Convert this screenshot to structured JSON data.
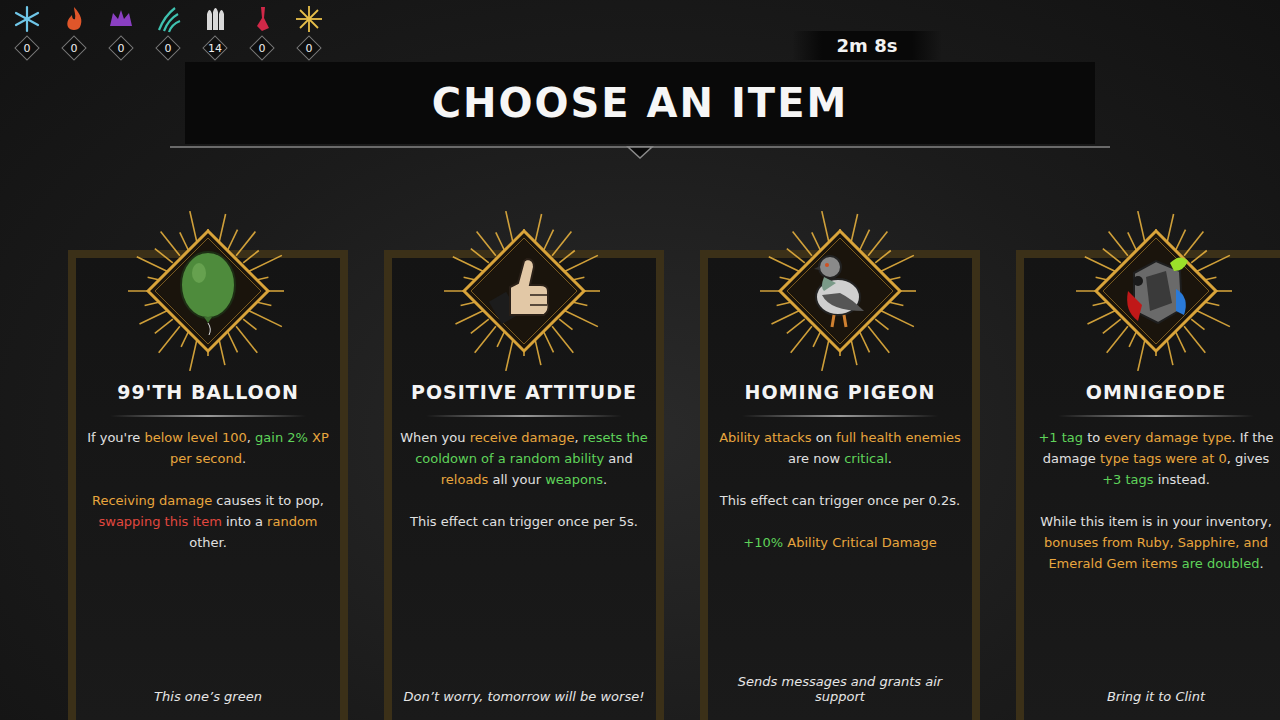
{
  "resources": [
    {
      "count": "0",
      "color": "#6fc6e8"
    },
    {
      "count": "0",
      "color": "#e0562a"
    },
    {
      "count": "0",
      "color": "#8a3fc2"
    },
    {
      "count": "0",
      "color": "#3fc2b0"
    },
    {
      "count": "14",
      "color": "#d8d8d8"
    },
    {
      "count": "0",
      "color": "#d02848"
    },
    {
      "count": "0",
      "color": "#e8c04a"
    }
  ],
  "timer": "2m 8s",
  "title": "CHOOSE AN ITEM",
  "cards": [
    {
      "name": "99'TH BALLOON",
      "paragraphs": [
        [
          {
            "text": "If you're ",
            "kind": "plain"
          },
          {
            "text": "below level 100",
            "kind": "gold"
          },
          {
            "text": ", ",
            "kind": "plain"
          },
          {
            "text": "gain 2%",
            "kind": "green"
          },
          {
            "text": " XP per second",
            "kind": "gold"
          },
          {
            "text": ".",
            "kind": "plain"
          }
        ],
        [
          {
            "text": "Receiving damage",
            "kind": "gold"
          },
          {
            "text": " causes it to pop, ",
            "kind": "plain"
          },
          {
            "text": "swapping this item",
            "kind": "red"
          },
          {
            "text": " into a ",
            "kind": "plain"
          },
          {
            "text": "random",
            "kind": "gold"
          },
          {
            "text": " other.",
            "kind": "plain"
          }
        ]
      ],
      "flavor": "This one’s green"
    },
    {
      "name": "POSITIVE ATTITUDE",
      "paragraphs": [
        [
          {
            "text": "When you ",
            "kind": "plain"
          },
          {
            "text": "receive damage",
            "kind": "gold"
          },
          {
            "text": ", ",
            "kind": "plain"
          },
          {
            "text": "resets the cooldown of a random ability",
            "kind": "green"
          },
          {
            "text": " and ",
            "kind": "plain"
          },
          {
            "text": "reloads",
            "kind": "gold"
          },
          {
            "text": " all your ",
            "kind": "plain"
          },
          {
            "text": "weapons",
            "kind": "green"
          },
          {
            "text": ".",
            "kind": "plain"
          }
        ],
        [
          {
            "text": "This effect can trigger once per 5s.",
            "kind": "plain"
          }
        ]
      ],
      "flavor": "Don’t worry, tomorrow will be worse!"
    },
    {
      "name": "HOMING PIGEON",
      "paragraphs": [
        [
          {
            "text": "Ability attacks",
            "kind": "gold"
          },
          {
            "text": " on ",
            "kind": "plain"
          },
          {
            "text": "full health enemies",
            "kind": "gold"
          },
          {
            "text": " are now ",
            "kind": "plain"
          },
          {
            "text": "critical",
            "kind": "green"
          },
          {
            "text": ".",
            "kind": "plain"
          }
        ],
        [
          {
            "text": "This effect can trigger once per 0.2s.",
            "kind": "plain"
          }
        ],
        [
          {
            "text": "+10%",
            "kind": "green"
          },
          {
            "text": " Ability Critical Damage",
            "kind": "gold"
          }
        ]
      ],
      "flavor": "Sends messages and grants air support"
    },
    {
      "name": "OMNIGEODE",
      "paragraphs": [
        [
          {
            "text": "+1 tag",
            "kind": "green"
          },
          {
            "text": " to ",
            "kind": "plain"
          },
          {
            "text": "every damage type",
            "kind": "gold"
          },
          {
            "text": ". If the damage ",
            "kind": "plain"
          },
          {
            "text": "type tags were at 0",
            "kind": "gold"
          },
          {
            "text": ", gives ",
            "kind": "plain"
          },
          {
            "text": "+3 tags",
            "kind": "green"
          },
          {
            "text": " instead.",
            "kind": "plain"
          }
        ],
        [
          {
            "text": "While this item is in your inventory, ",
            "kind": "plain"
          },
          {
            "text": "bonuses from Ruby, Sapphire, and Emerald Gem items",
            "kind": "gold"
          },
          {
            "text": " ",
            "kind": "plain"
          },
          {
            "text": "are doubled",
            "kind": "green"
          },
          {
            "text": ".",
            "kind": "plain"
          }
        ]
      ],
      "flavor": "Bring it to Clint"
    }
  ]
}
